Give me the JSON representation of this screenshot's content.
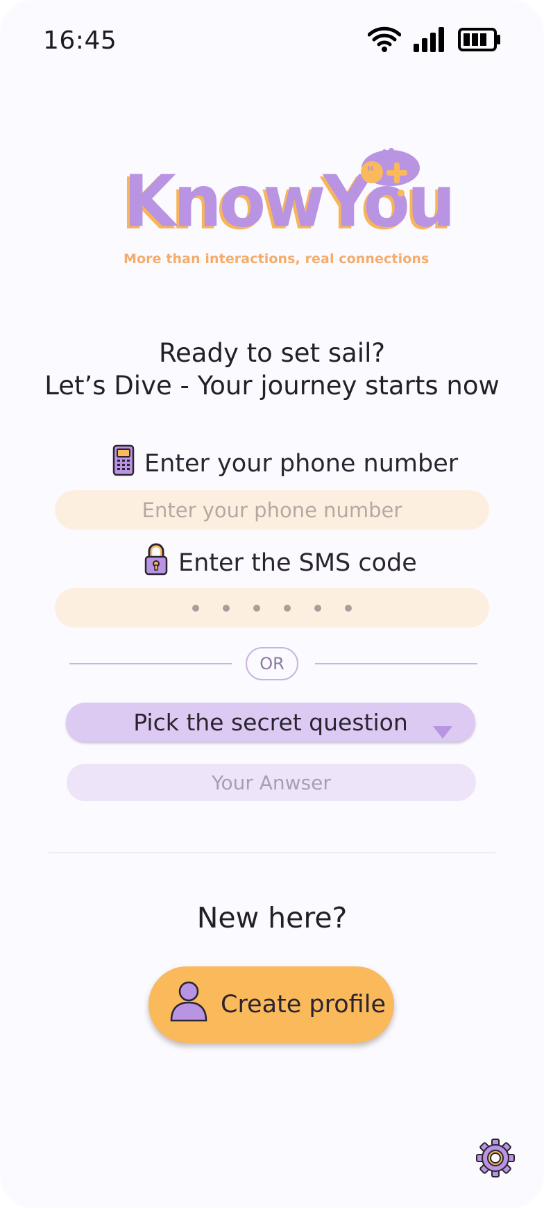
{
  "status_bar": {
    "time": "16:45"
  },
  "logo": {
    "wordmark": "KnowYou",
    "tagline": "More than interactions, real connections"
  },
  "heading": {
    "line1": "Ready to set sail?",
    "line2": "Let’s Dive - Your journey starts now"
  },
  "phone": {
    "label": "Enter your phone number",
    "placeholder": "Enter your phone number"
  },
  "sms": {
    "label": "Enter the SMS code",
    "placeholder": "● ● ● ● ● ●"
  },
  "divider": {
    "or_label": "OR"
  },
  "secret_question": {
    "selected": "Pick the secret question",
    "answer_placeholder": "Your Anwser"
  },
  "signup": {
    "prompt": "New here?",
    "button_label": "Create profile"
  },
  "icons": {
    "status": [
      "wifi-icon",
      "signal-icon",
      "battery-icon"
    ],
    "phone_label": "mobile-phone-icon",
    "sms_label": "lock-icon",
    "select": "triangle-down-icon",
    "create_button": "user-icon",
    "settings": "gear-icon"
  },
  "colors": {
    "brand_purple": "#b894e3",
    "brand_orange": "#fab95a",
    "input_peach": "#fdefe0",
    "select_lilac": "#dccaf2",
    "answer_lilac": "#eee4f9",
    "background": "#fbfaff"
  }
}
